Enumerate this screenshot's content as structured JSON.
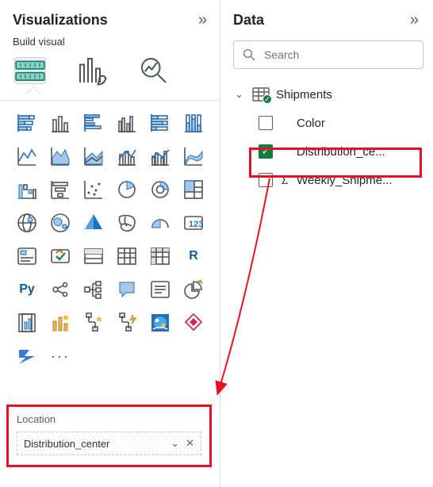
{
  "viz": {
    "title": "Visualizations",
    "subtitle": "Build visual",
    "tabs": {
      "build": "Build visual",
      "format": "Format visual",
      "analytics": "Analytics"
    },
    "more": "···"
  },
  "well": {
    "label": "Location",
    "field": "Distribution_center"
  },
  "data": {
    "title": "Data",
    "search_placeholder": "Search",
    "table": "Shipments",
    "fields": {
      "color": {
        "label": "Color",
        "checked": false,
        "numeric": false
      },
      "dist": {
        "label": "Distribution_ce...",
        "checked": true,
        "numeric": false
      },
      "ship": {
        "label": "Weekly_Shipme...",
        "checked": false,
        "numeric": true
      }
    }
  },
  "icons": {
    "collapse": "»",
    "expand_down": "⌄",
    "sigma": "∑",
    "check": "✓",
    "close": "✕",
    "search": "search"
  },
  "gallery_names": [
    "stacked-bar-chart",
    "stacked-column-chart",
    "clustered-bar-chart",
    "clustered-column-chart",
    "100-stacked-bar-chart",
    "100-stacked-column-chart",
    "line-chart",
    "area-chart",
    "stacked-area-chart",
    "line-stacked-column-chart",
    "line-clustered-column-chart",
    "ribbon-chart",
    "waterfall-chart",
    "funnel-chart",
    "scatter-chart",
    "pie-chart",
    "donut-chart",
    "treemap",
    "map",
    "filled-map",
    "azure-map",
    "shape-map",
    "gauge",
    "card",
    "multi-row-card",
    "kpi",
    "slicer",
    "table",
    "matrix",
    "r-visual",
    "python-visual",
    "key-influencers",
    "decomposition-tree",
    "qna",
    "smart-narrative",
    "paginated-report",
    "metrics",
    "power-apps",
    "power-automate",
    "sparkline-visual",
    "arcgis-map",
    "get-more-visuals",
    "power-automate-2",
    "more-visuals"
  ]
}
